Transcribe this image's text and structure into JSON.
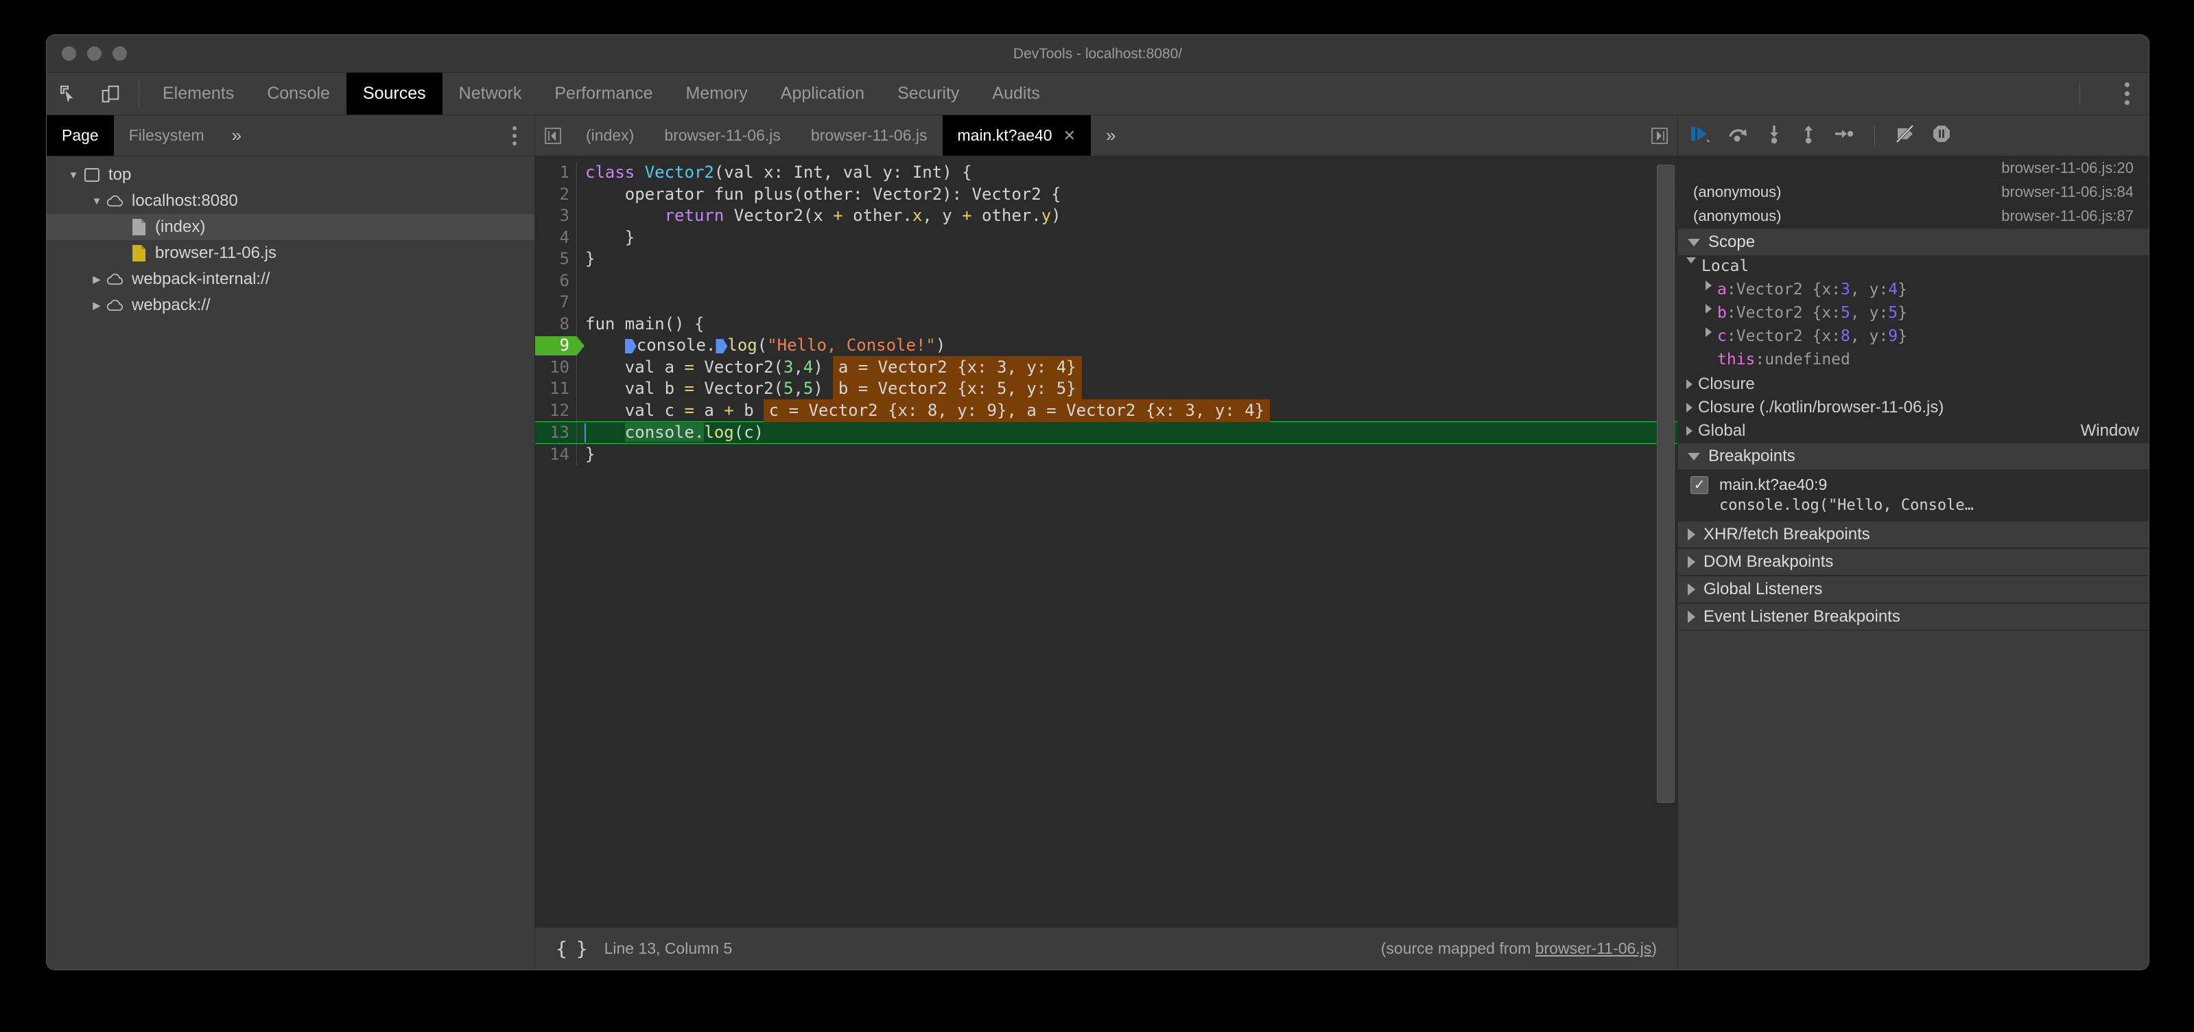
{
  "window": {
    "title": "DevTools - localhost:8080/"
  },
  "main_tabs": {
    "inspect_icon": "inspect-element-icon",
    "device_icon": "device-toolbar-icon",
    "items": [
      {
        "label": "Elements",
        "active": false
      },
      {
        "label": "Console",
        "active": false
      },
      {
        "label": "Sources",
        "active": true
      },
      {
        "label": "Network",
        "active": false
      },
      {
        "label": "Performance",
        "active": false
      },
      {
        "label": "Memory",
        "active": false
      },
      {
        "label": "Application",
        "active": false
      },
      {
        "label": "Security",
        "active": false
      },
      {
        "label": "Audits",
        "active": false
      }
    ],
    "more_icon": "more-vertical-icon"
  },
  "nav_pane": {
    "subtabs": [
      {
        "label": "Page",
        "active": true
      },
      {
        "label": "Filesystem",
        "active": false
      },
      {
        "label": "»",
        "active": false
      }
    ],
    "more_icon": "more-vertical-icon",
    "tree": [
      {
        "label": "top",
        "icon": "frame-icon",
        "twist": "open",
        "indent": 0,
        "selected": false
      },
      {
        "label": "localhost:8080",
        "icon": "cloud-icon",
        "twist": "open",
        "indent": 1,
        "selected": false
      },
      {
        "label": "(index)",
        "icon": "document-icon",
        "twist": "none",
        "indent": 2,
        "selected": true
      },
      {
        "label": "browser-11-06.js",
        "icon": "script-icon",
        "twist": "none",
        "indent": 2,
        "selected": false
      },
      {
        "label": "webpack-internal://",
        "icon": "cloud-icon",
        "twist": "closed",
        "indent": 1,
        "selected": false
      },
      {
        "label": "webpack://",
        "icon": "cloud-icon",
        "twist": "closed",
        "indent": 1,
        "selected": false
      }
    ]
  },
  "editor": {
    "scroll_left_icon": "scroll-tabs-left-icon",
    "scroll_right_icon": "scroll-tabs-right-icon",
    "tabs": [
      {
        "label": "(index)",
        "active": false,
        "closable": false
      },
      {
        "label": "browser-11-06.js",
        "active": false,
        "closable": false
      },
      {
        "label": "browser-11-06.js",
        "active": false,
        "closable": false
      },
      {
        "label": "main.kt?ae40",
        "active": true,
        "closable": true,
        "close_label": "✕"
      }
    ],
    "tabs_overflow": "»",
    "code_lines": [
      {
        "n": "1",
        "tokens": [
          {
            "t": "class ",
            "c": "kw"
          },
          {
            "t": "Vector2",
            "c": "typ"
          },
          {
            "t": "(val x: Int, val y: Int) {",
            "c": "pln"
          }
        ]
      },
      {
        "n": "2",
        "tokens": [
          {
            "t": "    operator fun plus(other: Vector2): Vector2 {",
            "c": "pln"
          }
        ]
      },
      {
        "n": "3",
        "tokens": [
          {
            "t": "        ",
            "c": "pln"
          },
          {
            "t": "return",
            "c": "kw"
          },
          {
            "t": " Vector2(x ",
            "c": "pln"
          },
          {
            "t": "+",
            "c": "op"
          },
          {
            "t": " other.",
            "c": "pln"
          },
          {
            "t": "x",
            "c": "op"
          },
          {
            "t": ", y ",
            "c": "pln"
          },
          {
            "t": "+",
            "c": "op"
          },
          {
            "t": " other.",
            "c": "pln"
          },
          {
            "t": "y",
            "c": "op"
          },
          {
            "t": ")",
            "c": "pln"
          }
        ]
      },
      {
        "n": "4",
        "tokens": [
          {
            "t": "    }",
            "c": "pln"
          }
        ]
      },
      {
        "n": "5",
        "tokens": [
          {
            "t": "}",
            "c": "pln"
          }
        ]
      },
      {
        "n": "6",
        "tokens": []
      },
      {
        "n": "7",
        "tokens": []
      },
      {
        "n": "8",
        "tokens": [
          {
            "t": "fun main() {",
            "c": "pln"
          }
        ]
      },
      {
        "n": "9",
        "breakpoint": true,
        "tokens": [
          {
            "t": "    ",
            "c": "pln"
          },
          {
            "t": "▶",
            "c": "bluemark"
          },
          {
            "t": "console.",
            "c": "pln"
          },
          {
            "t": "▶",
            "c": "bluemark"
          },
          {
            "t": "log",
            "c": "fn"
          },
          {
            "t": "(",
            "c": "pln"
          },
          {
            "t": "\"Hello, Console!\"",
            "c": "str"
          },
          {
            "t": ")",
            "c": "pln"
          }
        ]
      },
      {
        "n": "10",
        "annotation": "a = Vector2 {x: 3, y: 4}",
        "tokens": [
          {
            "t": "    val a ",
            "c": "pln"
          },
          {
            "t": "=",
            "c": "op"
          },
          {
            "t": " Vector2(",
            "c": "pln"
          },
          {
            "t": "3",
            "c": "num"
          },
          {
            "t": ",",
            "c": "pln"
          },
          {
            "t": "4",
            "c": "num"
          },
          {
            "t": ")",
            "c": "pln"
          }
        ]
      },
      {
        "n": "11",
        "annotation": "b = Vector2 {x: 5, y: 5}",
        "tokens": [
          {
            "t": "    val b ",
            "c": "pln"
          },
          {
            "t": "=",
            "c": "op"
          },
          {
            "t": " Vector2(",
            "c": "pln"
          },
          {
            "t": "5",
            "c": "num"
          },
          {
            "t": ",",
            "c": "pln"
          },
          {
            "t": "5",
            "c": "num"
          },
          {
            "t": ")",
            "c": "pln"
          }
        ]
      },
      {
        "n": "12",
        "annotation": "c = Vector2 {x: 8, y: 9}, a = Vector2 {x: 3, y: 4}",
        "tokens": [
          {
            "t": "    val c ",
            "c": "pln"
          },
          {
            "t": "=",
            "c": "op"
          },
          {
            "t": " a ",
            "c": "pln"
          },
          {
            "t": "+",
            "c": "op"
          },
          {
            "t": " b",
            "c": "pln"
          }
        ]
      },
      {
        "n": "13",
        "executing": true,
        "tokens": [
          {
            "t": "    ",
            "c": "pln"
          },
          {
            "t": "console.",
            "c": "exec-token"
          },
          {
            "t": "log",
            "c": "fn"
          },
          {
            "t": "(c)",
            "c": "pln"
          }
        ]
      },
      {
        "n": "14",
        "tokens": [
          {
            "t": "}",
            "c": "pln"
          }
        ]
      }
    ],
    "status": {
      "format_icon": "pretty-print-braces-icon",
      "position": "Line 13, Column 5",
      "source_map_prefix": "(source mapped from ",
      "source_map_link": "browser-11-06.js",
      "source_map_suffix": ")"
    }
  },
  "debugger": {
    "toolbar": [
      {
        "icon": "resume-script-execution-icon",
        "active": true
      },
      {
        "icon": "step-over-icon",
        "active": false
      },
      {
        "icon": "step-into-icon",
        "active": false
      },
      {
        "icon": "step-out-icon",
        "active": false
      },
      {
        "icon": "step-icon",
        "active": false
      },
      {
        "icon": "deactivate-breakpoints-icon",
        "active": false
      },
      {
        "icon": "pause-on-exceptions-icon",
        "active": false
      }
    ],
    "call_stack": [
      {
        "name": "",
        "location": "browser-11-06.js:20",
        "selected": true
      },
      {
        "name": "(anonymous)",
        "location": "browser-11-06.js:84",
        "selected": false
      },
      {
        "name": "(anonymous)",
        "location": "browser-11-06.js:87",
        "selected": false
      }
    ],
    "scope": {
      "title": "Scope",
      "expanded": true,
      "groups": [
        {
          "name": "Local",
          "expanded": true,
          "entries": [
            {
              "twist": "closed",
              "prop": "a",
              "sep": ": ",
              "type": "Vector2 {x: ",
              "v1": "3",
              "mid": ", y: ",
              "v2": "4",
              "end": "}"
            },
            {
              "twist": "closed",
              "prop": "b",
              "sep": ": ",
              "type": "Vector2 {x: ",
              "v1": "5",
              "mid": ", y: ",
              "v2": "5",
              "end": "}"
            },
            {
              "twist": "closed",
              "prop": "c",
              "sep": ": ",
              "type": "Vector2 {x: ",
              "v1": "8",
              "mid": ", y: ",
              "v2": "9",
              "end": "}"
            },
            {
              "twist": "none",
              "prop": "this",
              "sep": ": ",
              "type": "undefined",
              "v1": "",
              "mid": "",
              "v2": "",
              "end": ""
            }
          ]
        }
      ],
      "closures": [
        {
          "label": "Closure",
          "right": "",
          "expanded": false
        },
        {
          "label": "Closure (./kotlin/browser-11-06.js)",
          "right": "",
          "expanded": false
        },
        {
          "label": "Global",
          "right": "Window",
          "expanded": false
        }
      ]
    },
    "breakpoints": {
      "title": "Breakpoints",
      "expanded": true,
      "items": [
        {
          "checked": true,
          "check_glyph": "✓",
          "location": "main.kt?ae40:9",
          "snippet": "console.log(\"Hello, Console…"
        }
      ]
    },
    "sections": [
      {
        "label": "XHR/fetch Breakpoints",
        "expanded": false
      },
      {
        "label": "DOM Breakpoints",
        "expanded": false
      },
      {
        "label": "Global Listeners",
        "expanded": false
      },
      {
        "label": "Event Listener Breakpoints",
        "expanded": false
      }
    ]
  }
}
